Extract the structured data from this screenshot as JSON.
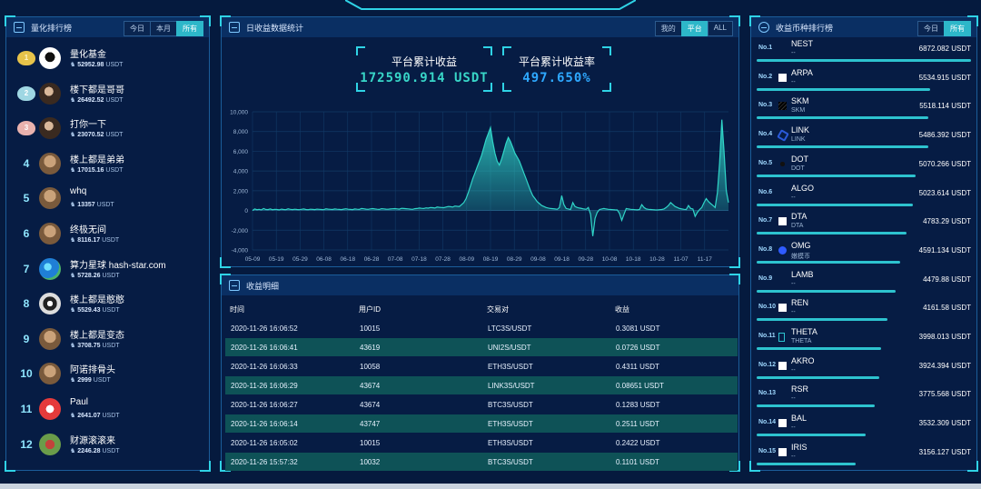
{
  "left": {
    "title": "量化排行榜",
    "tabs": [
      "今日",
      "本月",
      "所有"
    ],
    "active_tab": 2,
    "items": [
      {
        "rank": "1",
        "name": "量化基金",
        "value": "52952.98",
        "unit": "USDT",
        "avatar": "white"
      },
      {
        "rank": "2",
        "name": "楼下都是哥哥",
        "value": "26492.52",
        "unit": "USDT",
        "avatar": "person"
      },
      {
        "rank": "3",
        "name": "打你一下",
        "value": "23070.52",
        "unit": "USDT",
        "avatar": "person"
      },
      {
        "rank": "4",
        "name": "楼上都是弟弟",
        "value": "17015.16",
        "unit": "USDT",
        "avatar": "default"
      },
      {
        "rank": "5",
        "name": "whq",
        "value": "13357",
        "unit": "USDT",
        "avatar": "default"
      },
      {
        "rank": "6",
        "name": "终极无间",
        "value": "8116.17",
        "unit": "USDT",
        "avatar": "default"
      },
      {
        "rank": "7",
        "name": "算力星球 hash-star.com",
        "value": "5728.26",
        "unit": "USDT",
        "avatar": "blue"
      },
      {
        "rank": "8",
        "name": "楼上都是憨憨",
        "value": "5529.43",
        "unit": "USDT",
        "avatar": "dark"
      },
      {
        "rank": "9",
        "name": "楼上都是变态",
        "value": "3708.75",
        "unit": "USDT",
        "avatar": "default"
      },
      {
        "rank": "10",
        "name": "阿诺排骨头",
        "value": "2999",
        "unit": "USDT",
        "avatar": "default"
      },
      {
        "rank": "11",
        "name": "Paul",
        "value": "2641.07",
        "unit": "USDT",
        "avatar": "red"
      },
      {
        "rank": "12",
        "name": "财源滚滚来",
        "value": "2246.28",
        "unit": "USDT",
        "avatar": "green"
      }
    ]
  },
  "center": {
    "title": "日收益数据统计",
    "tabs": [
      "我的",
      "平台",
      "ALL"
    ],
    "active_tab": 1,
    "total_profit_label": "平台累计收益",
    "total_profit_value": "172590.914 USDT",
    "profit_rate_label": "平台累计收益率",
    "profit_rate_value": "497.650%",
    "colors": {
      "profit": "#38d6c8",
      "rate": "#2ea8ff",
      "line": "#30d5c8"
    }
  },
  "chart_data": {
    "type": "area",
    "x_tick_labels": [
      "05-09",
      "05-19",
      "05-29",
      "06-08",
      "06-18",
      "06-28",
      "07-08",
      "07-18",
      "07-28",
      "08-09",
      "08-19",
      "08-29",
      "09-08",
      "09-18",
      "09-28",
      "10-08",
      "10-18",
      "10-28",
      "11-07",
      "11-17"
    ],
    "y_tick_labels": [
      "10,000",
      "8,000",
      "6,000",
      "4,000",
      "2,000",
      "0",
      "-2,000",
      "-4,000"
    ],
    "ylim": [
      -4000,
      10000
    ],
    "grid": true,
    "series": [
      {
        "values": [
          0,
          150,
          80,
          120,
          60,
          200,
          100,
          90,
          150,
          80,
          120,
          100,
          60,
          140,
          100,
          80,
          160,
          120,
          90,
          130,
          100,
          80,
          120,
          150,
          100,
          80,
          130,
          110,
          90,
          140,
          120,
          100,
          80,
          160,
          140,
          120,
          100,
          150,
          130,
          110,
          90,
          140,
          170,
          130,
          110,
          90,
          150,
          130,
          110,
          200,
          170,
          140,
          120,
          160,
          190,
          150,
          130,
          110,
          180,
          160,
          140,
          130,
          150,
          170,
          190,
          160,
          140,
          220,
          200,
          180,
          160,
          140,
          120,
          180,
          200,
          250,
          220,
          200,
          260,
          240,
          300,
          280,
          250,
          350,
          320,
          300,
          280,
          350,
          400,
          380,
          350,
          450,
          420,
          400,
          600,
          800,
          1200,
          1800,
          2500,
          3200,
          3800,
          4400,
          5000,
          5600,
          6400,
          7200,
          7800,
          8400,
          7000,
          5800,
          5000,
          4600,
          5200,
          6000,
          6800,
          7400,
          7000,
          6400,
          5800,
          5400,
          5000,
          4400,
          3800,
          3200,
          2600,
          2000,
          1500,
          1200,
          900,
          700,
          500,
          400,
          300,
          250,
          200,
          180,
          150,
          120,
          300,
          1500,
          600,
          200,
          150,
          100,
          800,
          400,
          300,
          250,
          200,
          150,
          120,
          300,
          -400,
          -2600,
          -800,
          -200,
          100,
          150,
          200,
          150,
          120,
          100,
          80,
          60,
          50,
          -300,
          -1000,
          -400,
          200,
          150,
          120,
          100,
          80,
          60,
          100,
          600,
          300,
          150,
          120,
          100,
          80,
          60,
          50,
          80,
          100,
          150,
          300,
          500,
          800,
          600,
          400,
          300,
          200,
          150,
          120,
          100,
          500,
          200,
          150,
          -600,
          -200,
          100,
          300,
          800,
          1200,
          900,
          700,
          500,
          300,
          1800,
          4800,
          9200,
          6000,
          2000,
          800
        ]
      }
    ]
  },
  "table": {
    "title": "收益明细",
    "headers": [
      "时间",
      "用户ID",
      "交易对",
      "收益"
    ],
    "rows": [
      [
        "2020-11-26 16:06:52",
        "10015",
        "LTC3S/USDT",
        "0.3081 USDT"
      ],
      [
        "2020-11-26 16:06:41",
        "43619",
        "UNI2S/USDT",
        "0.0726 USDT"
      ],
      [
        "2020-11-26 16:06:33",
        "10058",
        "ETH3S/USDT",
        "0.4311 USDT"
      ],
      [
        "2020-11-26 16:06:29",
        "43674",
        "LINK3S/USDT",
        "0.08651 USDT"
      ],
      [
        "2020-11-26 16:06:27",
        "43674",
        "BTC3S/USDT",
        "0.1283 USDT"
      ],
      [
        "2020-11-26 16:06:14",
        "43747",
        "ETH3S/USDT",
        "0.2511 USDT"
      ],
      [
        "2020-11-26 16:05:02",
        "10015",
        "ETH3S/USDT",
        "0.2422 USDT"
      ],
      [
        "2020-11-26 15:57:32",
        "10032",
        "BTC3S/USDT",
        "0.1101 USDT"
      ]
    ]
  },
  "right": {
    "title": "收益币种排行榜",
    "tabs": [
      "今日",
      "所有"
    ],
    "active_tab": 1,
    "items": [
      {
        "no": "No.1",
        "name": "NEST",
        "sub": "--",
        "value": "6872.082 USDT",
        "bar": 1.0,
        "icon": "none"
      },
      {
        "no": "No.2",
        "name": "ARPA",
        "sub": "--",
        "value": "5534.915 USDT",
        "bar": 0.81,
        "icon": "square"
      },
      {
        "no": "No.3",
        "name": "SKM",
        "sub": "SKM",
        "value": "5518.114 USDT",
        "bar": 0.8,
        "icon": "stripes"
      },
      {
        "no": "No.4",
        "name": "LINK",
        "sub": "LINK",
        "value": "5486.392 USDT",
        "bar": 0.8,
        "icon": "hex"
      },
      {
        "no": "No.5",
        "name": "DOT",
        "sub": "DOT",
        "value": "5070.266 USDT",
        "bar": 0.74,
        "icon": "dot"
      },
      {
        "no": "No.6",
        "name": "ALGO",
        "sub": "--",
        "value": "5023.614 USDT",
        "bar": 0.73,
        "icon": "none"
      },
      {
        "no": "No.7",
        "name": "DTA",
        "sub": "DTA",
        "value": "4783.29 USDT",
        "bar": 0.7,
        "icon": "square"
      },
      {
        "no": "No.8",
        "name": "OMG",
        "sub": "嫩模币",
        "value": "4591.134 USDT",
        "bar": 0.67,
        "icon": "omg"
      },
      {
        "no": "No.9",
        "name": "LAMB",
        "sub": "--",
        "value": "4479.88 USDT",
        "bar": 0.65,
        "icon": "none"
      },
      {
        "no": "No.10",
        "name": "REN",
        "sub": "--",
        "value": "4161.58 USDT",
        "bar": 0.61,
        "icon": "square"
      },
      {
        "no": "No.11",
        "name": "THETA",
        "sub": "THETA",
        "value": "3998.013 USDT",
        "bar": 0.58,
        "icon": "theta"
      },
      {
        "no": "No.12",
        "name": "AKRO",
        "sub": "--",
        "value": "3924.394 USDT",
        "bar": 0.57,
        "icon": "square"
      },
      {
        "no": "No.13",
        "name": "RSR",
        "sub": "--",
        "value": "3775.568 USDT",
        "bar": 0.55,
        "icon": "none"
      },
      {
        "no": "No.14",
        "name": "BAL",
        "sub": "--",
        "value": "3532.309 USDT",
        "bar": 0.51,
        "icon": "square"
      },
      {
        "no": "No.15",
        "name": "IRIS",
        "sub": "--",
        "value": "3156.127 USDT",
        "bar": 0.46,
        "icon": "square"
      }
    ]
  }
}
